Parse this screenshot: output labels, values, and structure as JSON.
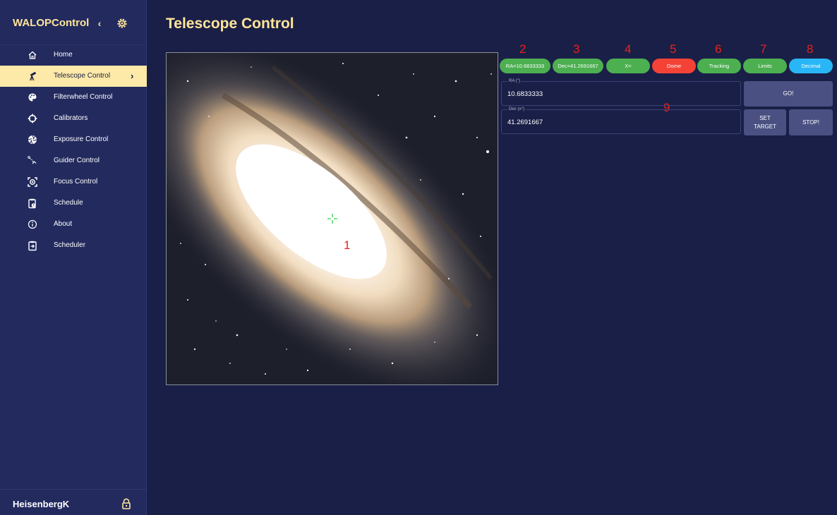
{
  "app": {
    "name": "WALOPControl",
    "collapse_symbol": "‹",
    "settings_icon": "gear-icon",
    "user": "HeisenbergK",
    "lock_icon": "lock-icon",
    "colors": {
      "accent": "#ffe59a",
      "sidebar_bg": "#222a5e",
      "page_bg": "#1a1f47",
      "active_item_bg": "#fde9a8",
      "button_bg": "#4a5182"
    }
  },
  "sidebar": {
    "items": [
      {
        "label": "Home",
        "icon": "home-icon"
      },
      {
        "label": "Telescope Control",
        "icon": "telescope-icon",
        "active": true,
        "chevron": "›"
      },
      {
        "label": "Filterwheel Control",
        "icon": "palette-icon"
      },
      {
        "label": "Calibrators",
        "icon": "crosshair-icon"
      },
      {
        "label": "Exposure Control",
        "icon": "aperture-icon"
      },
      {
        "label": "Guider Control",
        "icon": "guider-icon"
      },
      {
        "label": "Focus Control",
        "icon": "focus-icon"
      },
      {
        "label": "Schedule",
        "icon": "clipboard-clock-icon"
      },
      {
        "label": "About",
        "icon": "info-icon"
      },
      {
        "label": "Scheduler",
        "icon": "clipboard-arrow-icon"
      }
    ]
  },
  "main": {
    "title": "Telescope Control",
    "image_alt": "galaxy sky image",
    "status_pills": [
      {
        "label": "RA=10.6833333",
        "color": "green"
      },
      {
        "label": "Dec=41.2691667",
        "color": "green"
      },
      {
        "label": "X=",
        "color": "green"
      },
      {
        "label": "Dome",
        "color": "red"
      },
      {
        "label": "Tracking",
        "color": "green"
      },
      {
        "label": "Limits",
        "color": "green"
      },
      {
        "label": "Decimal",
        "color": "blue"
      }
    ],
    "ra_field": {
      "label": "RA (°)",
      "value": "10.6833333"
    },
    "dec_field": {
      "label": "Dec (±°)",
      "value": "41.2691667"
    },
    "buttons": {
      "go": "GO!",
      "set_target": "SET TARGET",
      "stop": "STOP!"
    },
    "annotations": [
      "1",
      "2",
      "3",
      "4",
      "5",
      "6",
      "7",
      "8",
      "9"
    ]
  }
}
